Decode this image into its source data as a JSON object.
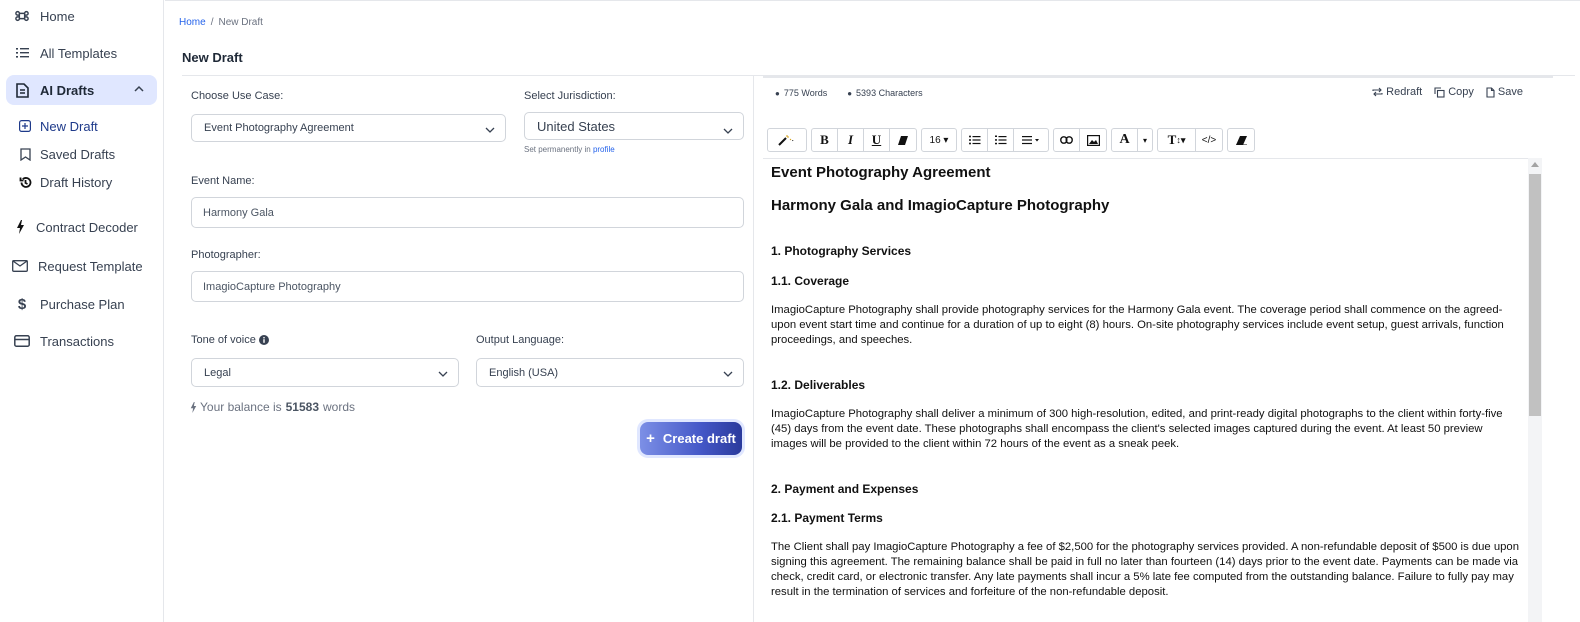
{
  "sidebar": {
    "items": [
      {
        "label": "Home",
        "icon": "command-icon"
      },
      {
        "label": "All Templates",
        "icon": "list-icon"
      },
      {
        "label": "AI Drafts",
        "icon": "document-icon",
        "expanded": true
      },
      {
        "label": "Contract Decoder",
        "icon": "lightning-icon"
      },
      {
        "label": "Request Template",
        "icon": "envelope-icon"
      },
      {
        "label": "Purchase Plan",
        "icon": "dollar-icon"
      },
      {
        "label": "Transactions",
        "icon": "credit-card-icon"
      }
    ],
    "sub_items": [
      {
        "label": "New Draft",
        "icon": "plus-square-icon",
        "active": true
      },
      {
        "label": "Saved Drafts",
        "icon": "bookmark-icon"
      },
      {
        "label": "Draft History",
        "icon": "history-icon"
      }
    ]
  },
  "breadcrumb": {
    "home": "Home",
    "separator": "/",
    "current": "New Draft"
  },
  "page_title": "New Draft",
  "form": {
    "use_case": {
      "label": "Choose Use Case:",
      "value": "Event Photography Agreement"
    },
    "jurisdiction": {
      "label": "Select Jurisdiction:",
      "value": "United States",
      "hint_prefix": "Set permanently in",
      "hint_link": "profile"
    },
    "event_name": {
      "label": "Event Name:",
      "value": "Harmony Gala"
    },
    "photographer": {
      "label": "Photographer:",
      "value": "ImagioCapture Photography"
    },
    "tone": {
      "label": "Tone of voice",
      "value": "Legal"
    },
    "language": {
      "label": "Output Language:",
      "value": "English (USA)"
    },
    "balance": {
      "prefix": "Your balance is",
      "amount": "51583",
      "suffix": "words"
    },
    "create_button": "Create draft"
  },
  "editor": {
    "stats": {
      "words": "775 Words",
      "characters": "5393 Characters"
    },
    "actions": {
      "redraft": "Redraft",
      "copy": "Copy",
      "save": "Save"
    },
    "toolbar": {
      "font_size": "16"
    },
    "document": {
      "title": "Event Photography Agreement",
      "subtitle": "Harmony Gala and ImagioCapture Photography",
      "s1": "1. Photography Services",
      "s1_1": "1.1. Coverage",
      "p1": "ImagioCapture Photography shall provide photography services for the Harmony Gala event. The coverage period shall commence on the agreed-upon event start time and continue for a duration of up to eight (8) hours. On-site photography services include event setup, guest arrivals, function proceedings, and speeches.",
      "s1_2": "1.2. Deliverables",
      "p2": "ImagioCapture Photography shall deliver a minimum of 300 high-resolution, edited, and print-ready digital photographs to the client within forty-five (45) days from the event date. These photographs shall encompass the client's selected images captured during the event. At least 50 preview images will be provided to the client within 72 hours of the event as a sneak peek.",
      "s2": "2. Payment and Expenses",
      "s2_1": "2.1. Payment Terms",
      "p3": "The Client shall pay ImagioCapture Photography a fee of $2,500 for the photography services provided. A non-refundable deposit of $500 is due upon signing this agreement. The remaining balance shall be paid in full no later than fourteen (14) days prior to the event date. Payments can be made via check, credit card, or electronic transfer. Any late payments shall incur a 5% late fee computed from the outstanding balance. Failure to fully pay may result in the termination of services and forfeiture of the non-refundable deposit."
    }
  },
  "colors": {
    "accent": "#4457c7",
    "active_bg": "#e0e7ff",
    "link": "#2563eb"
  }
}
